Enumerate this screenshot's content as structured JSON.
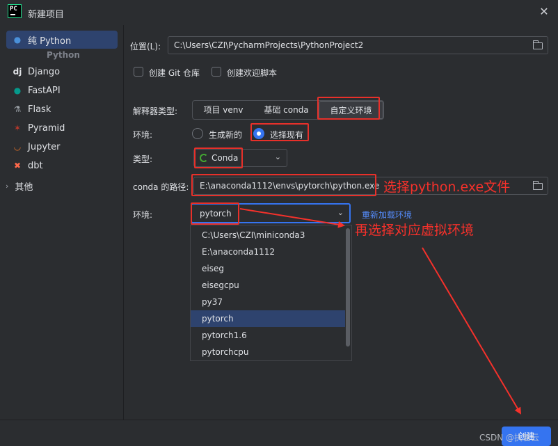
{
  "window": {
    "title": "新建项目",
    "close_glyph": "✕"
  },
  "sidebar": {
    "items": [
      {
        "label": "纯 Python",
        "icon": "python-icon",
        "glyph": "🐍"
      },
      {
        "label": "Django",
        "icon": "django-icon",
        "glyph": "dj"
      },
      {
        "label": "FastAPI",
        "icon": "fastapi-icon",
        "glyph": "⚡"
      },
      {
        "label": "Flask",
        "icon": "flask-icon",
        "glyph": "🧪"
      },
      {
        "label": "Pyramid",
        "icon": "pyramid-icon",
        "glyph": "◆"
      },
      {
        "label": "Jupyter",
        "icon": "jupyter-icon",
        "glyph": "◯"
      },
      {
        "label": "dbt",
        "icon": "dbt-icon",
        "glyph": "✖"
      },
      {
        "label": "其他",
        "icon": "chevron-right-icon",
        "glyph": "›"
      }
    ],
    "group_label": "Python"
  },
  "form": {
    "location_label": "位置(L):",
    "location_value": "C:\\Users\\CZI\\PycharmProjects\\PythonProject2",
    "git_repo_label": "创建 Git 仓库",
    "welcome_script_label": "创建欢迎脚本",
    "interpreter_type_label": "解释器类型:",
    "interpreter_tabs": [
      "项目 venv",
      "基础 conda",
      "自定义环境"
    ],
    "env_label": "环境:",
    "env_options": [
      "生成新的",
      "选择现有"
    ],
    "type_label": "类型:",
    "type_value": "Conda",
    "conda_path_label": "conda 的路径:",
    "conda_path_value": "E:\\anaconda1112\\envs\\pytorch\\python.exe",
    "env2_label": "环境:",
    "env_value": "pytorch",
    "reload_link": "重新加载环境"
  },
  "dropdown": {
    "items": [
      "C:\\Users\\CZI\\miniconda3",
      "E:\\anaconda1112",
      "eiseg",
      "eisegcpu",
      "py37",
      "pytorch",
      "pytorch1.6",
      "pytorchcpu"
    ],
    "selected": "pytorch"
  },
  "annotations": {
    "select_exe": "选择python.exe文件",
    "select_env": "再选择对应虚拟环境",
    "color": "#f5312b"
  },
  "footer": {
    "create_label": "创建",
    "watermark": "CSDN @执着云"
  },
  "colors": {
    "accent": "#3574f0",
    "selection": "#2e436e",
    "background": "#2b2d30",
    "link": "#548af7"
  }
}
